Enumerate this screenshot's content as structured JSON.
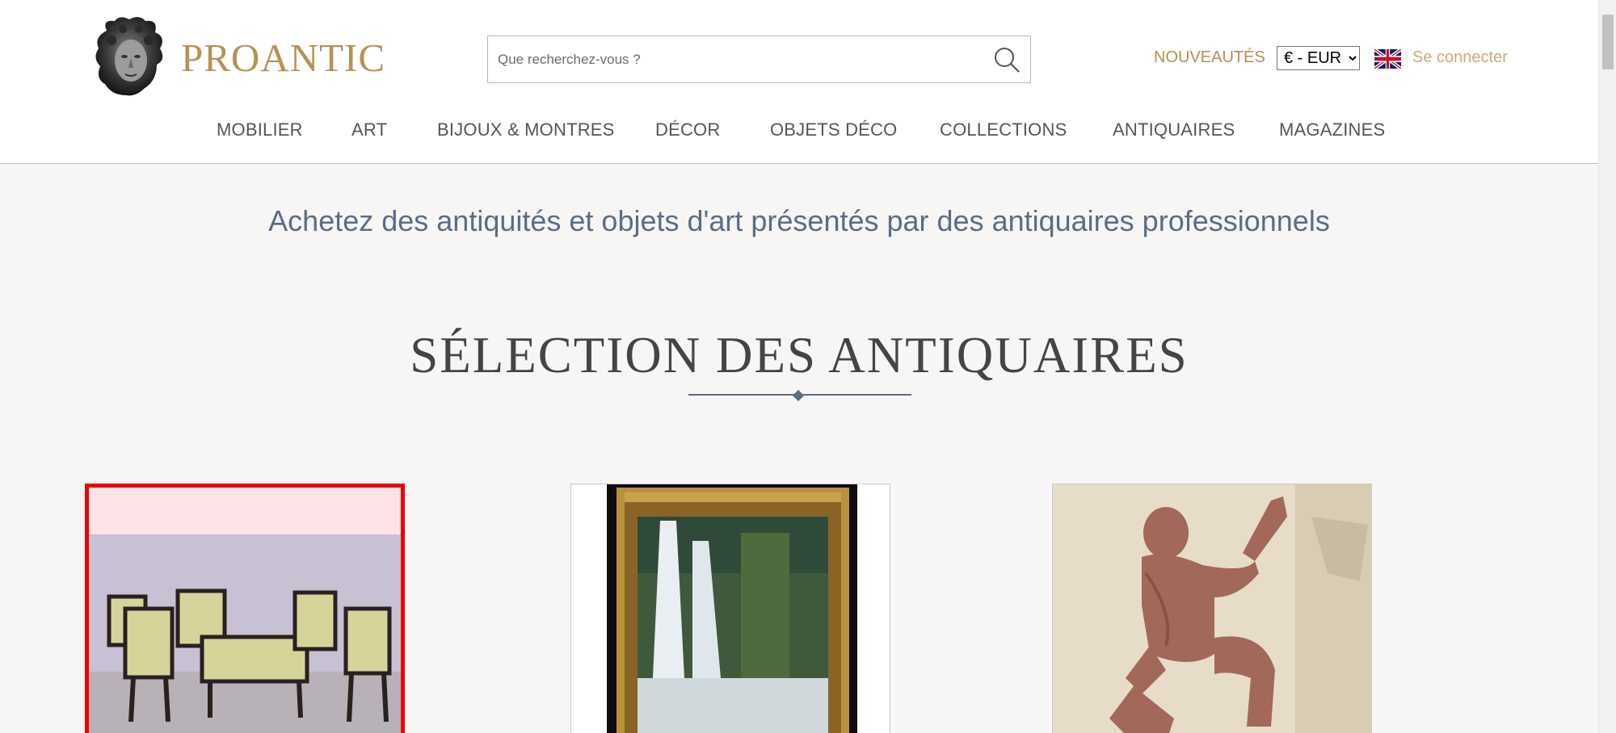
{
  "header": {
    "logo_text": "PROANTIC",
    "search": {
      "placeholder": "Que recherchez-vous ?"
    },
    "nouveautes_label": "NOUVEAUTÉS",
    "currency": {
      "selected": "€ - EUR"
    },
    "language_flag": "uk-flag-icon",
    "login_label": "Se connecter"
  },
  "nav": {
    "items": [
      {
        "label": "MOBILIER"
      },
      {
        "label": "ART"
      },
      {
        "label": "BIJOUX & MONTRES"
      },
      {
        "label": "DÉCOR"
      },
      {
        "label": "OBJETS DÉCO"
      },
      {
        "label": "COLLECTIONS"
      },
      {
        "label": "ANTIQUAIRES"
      },
      {
        "label": "MAGAZINES"
      }
    ]
  },
  "main": {
    "tagline": "Achetez des antiquités et objets d'art présentés par des antiquaires professionnels",
    "section_title": "SÉLECTION DES ANTIQUAIRES"
  },
  "colors": {
    "gold": "#b49255",
    "slate": "#5a6d85",
    "highlight": "#ee0000"
  }
}
